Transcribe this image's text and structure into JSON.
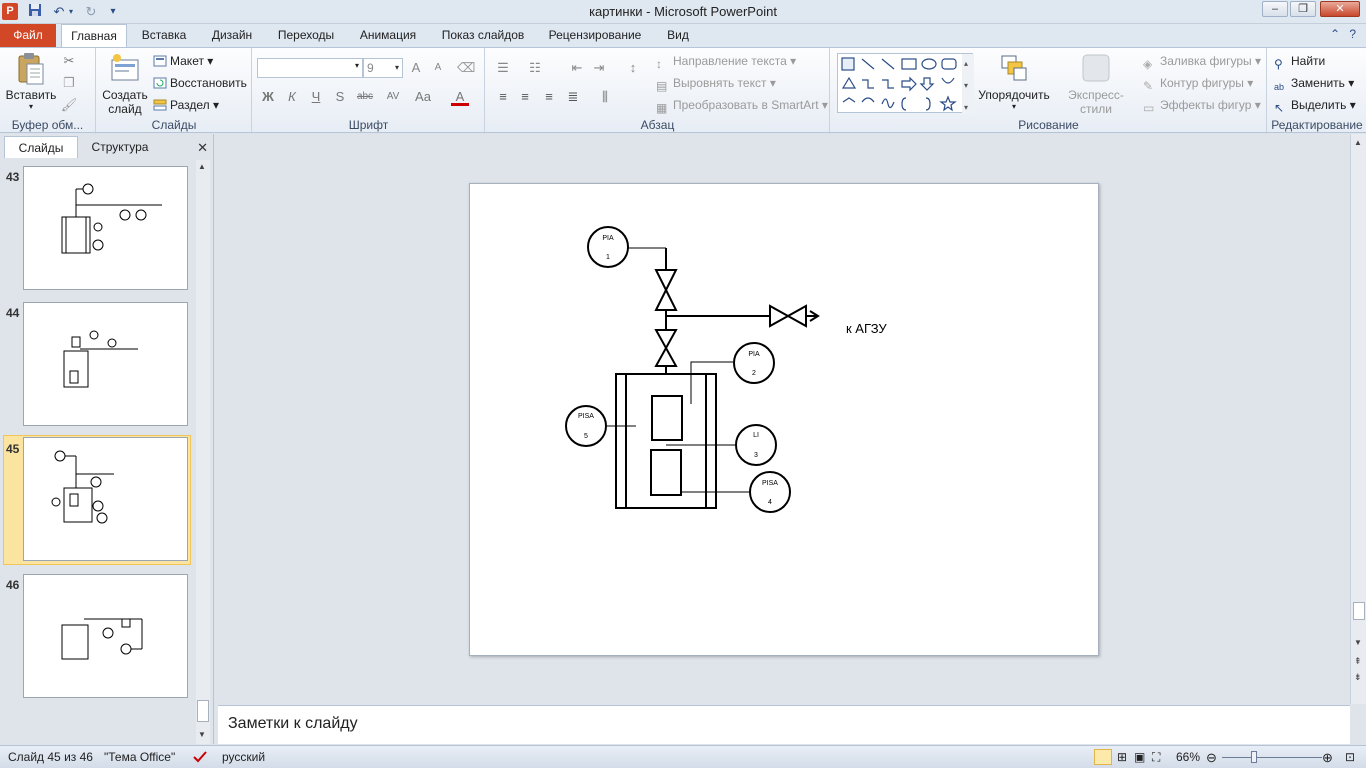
{
  "window": {
    "title": "картинки - Microsoft PowerPoint"
  },
  "ribbon_tabs": {
    "file": "Файл",
    "items": [
      "Главная",
      "Вставка",
      "Дизайн",
      "Переходы",
      "Анимация",
      "Показ слайдов",
      "Рецензирование",
      "Вид"
    ],
    "active": "Главная"
  },
  "clipboard": {
    "paste": "Вставить",
    "group": "Буфер обм..."
  },
  "slides_group": {
    "new_slide_line1": "Создать",
    "new_slide_line2": "слайд",
    "layout": "Макет",
    "reset": "Восстановить",
    "section": "Раздел",
    "group": "Слайды"
  },
  "font_group": {
    "font_name": "",
    "font_size": "9",
    "bold": "Ж",
    "italic": "К",
    "underline": "Ч",
    "shadow": "S",
    "strike": "abc",
    "spacing": "AV",
    "case": "Aa",
    "color": "A",
    "grow": "A",
    "shrink": "A",
    "group": "Шрифт"
  },
  "paragraph_group": {
    "text_direction": "Направление текста",
    "align_text": "Выровнять текст",
    "smartart": "Преобразовать в SmartArt",
    "group": "Абзац"
  },
  "drawing_group": {
    "arrange": "Упорядочить",
    "quick_styles": "Экспресс-стили",
    "fill": "Заливка фигуры",
    "outline": "Контур фигуры",
    "effects": "Эффекты фигур",
    "group": "Рисование"
  },
  "editing_group": {
    "find": "Найти",
    "replace": "Заменить",
    "select": "Выделить",
    "group": "Редактирование"
  },
  "left_panel": {
    "tab_slides": "Слайды",
    "tab_outline": "Структура",
    "selected_slide": "45",
    "thumbnails": [
      "43",
      "44",
      "45",
      "46"
    ]
  },
  "slide": {
    "label_agzu": "к АГЗУ",
    "instruments": [
      {
        "tag": "PIA",
        "num": "1"
      },
      {
        "tag": "PIA",
        "num": "2"
      },
      {
        "tag": "LI",
        "num": "3"
      },
      {
        "tag": "PISA",
        "num": "4"
      },
      {
        "tag": "PISA",
        "num": "5"
      }
    ]
  },
  "notes": {
    "placeholder": "Заметки к слайду"
  },
  "status": {
    "slide_info": "Слайд 45 из 46",
    "theme": "\"Тема Office\"",
    "language": "русский",
    "zoom": "66%"
  }
}
